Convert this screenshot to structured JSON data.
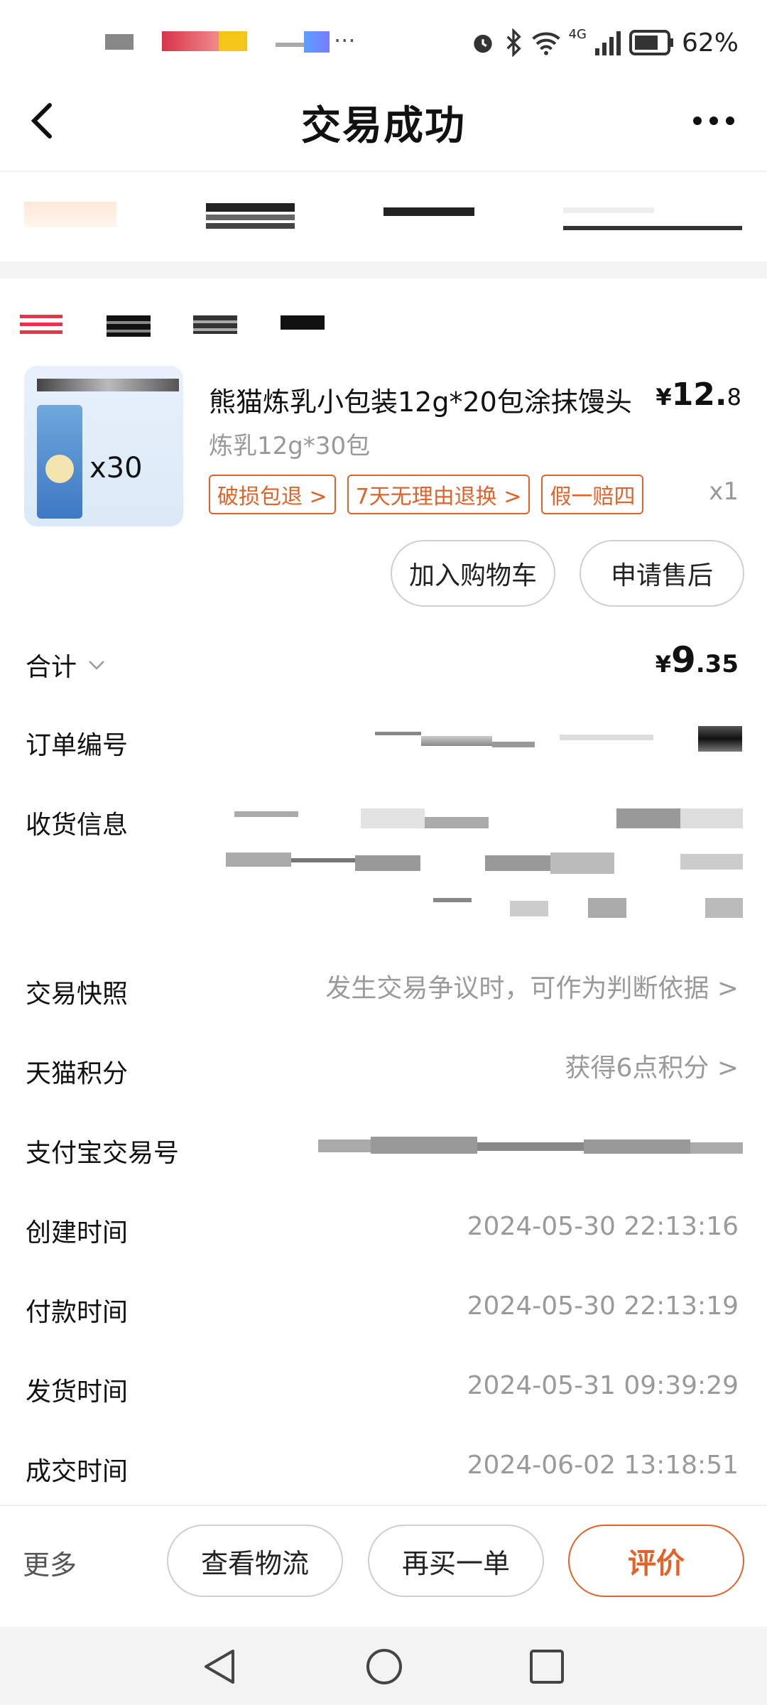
{
  "status_bar": {
    "battery": "62%",
    "network": "4G"
  },
  "header": {
    "title": "交易成功"
  },
  "product": {
    "title": "熊猫炼乳小包装12g*20包涂抹馒头",
    "price_symbol": "¥",
    "price_int": "12.",
    "price_dec": "8",
    "spec": "炼乳12g*30包",
    "thumb_count": "x30",
    "tags": [
      "破损包退 >",
      "7天无理由退换 >",
      "假一赔四"
    ],
    "quantity": "x1",
    "add_cart_label": "加入购物车",
    "after_sale_label": "申请售后"
  },
  "total": {
    "label": "合计",
    "symbol": "¥",
    "int": "9",
    "dec": ".35"
  },
  "rows": {
    "order_no_label": "订单编号",
    "shipping_label": "收货信息",
    "snapshot_label": "交易快照",
    "snapshot_value": "发生交易争议时，可作为判断依据 >",
    "points_label": "天猫积分",
    "points_value": "获得6点积分 >",
    "alipay_label": "支付宝交易号",
    "created_label": "创建时间",
    "created_value": "2024-05-30 22:13:16",
    "paid_label": "付款时间",
    "paid_value": "2024-05-30 22:13:19",
    "shipped_label": "发货时间",
    "shipped_value": "2024-05-31 09:39:29",
    "done_label": "成交时间",
    "done_value": "2024-06-02 13:18:51"
  },
  "bottom": {
    "more_label": "更多",
    "logistics_label": "查看物流",
    "rebuy_label": "再买一单",
    "review_label": "评价"
  },
  "colors": {
    "accent": "#e0632a",
    "muted": "#9a9a9a"
  }
}
